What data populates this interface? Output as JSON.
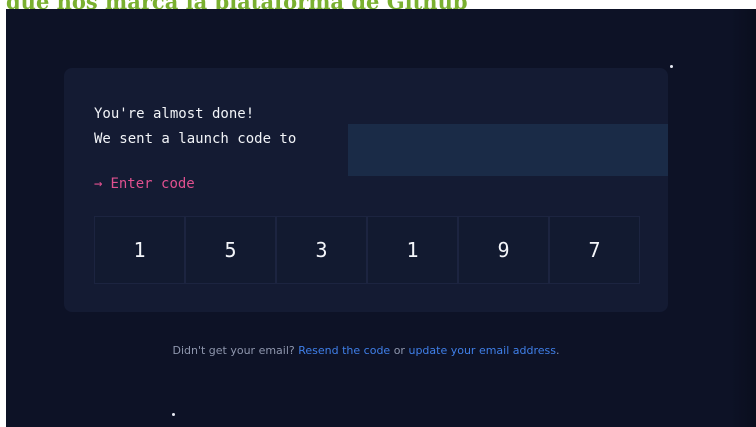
{
  "caption": "que nos marca la plataforma de Github",
  "card": {
    "line_1": "You're almost done!",
    "line_2": "We sent a launch code to",
    "enter_code_arrow": "→",
    "enter_code_label": "Enter code",
    "code_digits": [
      "1",
      "5",
      "3",
      "1",
      "9",
      "7"
    ]
  },
  "footer": {
    "prefix": "Didn't get your email?",
    "resend_link": "Resend the code",
    "middle": "or",
    "update_link": "update your email address",
    "suffix": "."
  },
  "colors": {
    "background": "#0d1226",
    "card": "#141b33",
    "accent_pink": "#e0508f",
    "link_blue": "#3f7fe8",
    "caption_green": "#7ab030"
  }
}
